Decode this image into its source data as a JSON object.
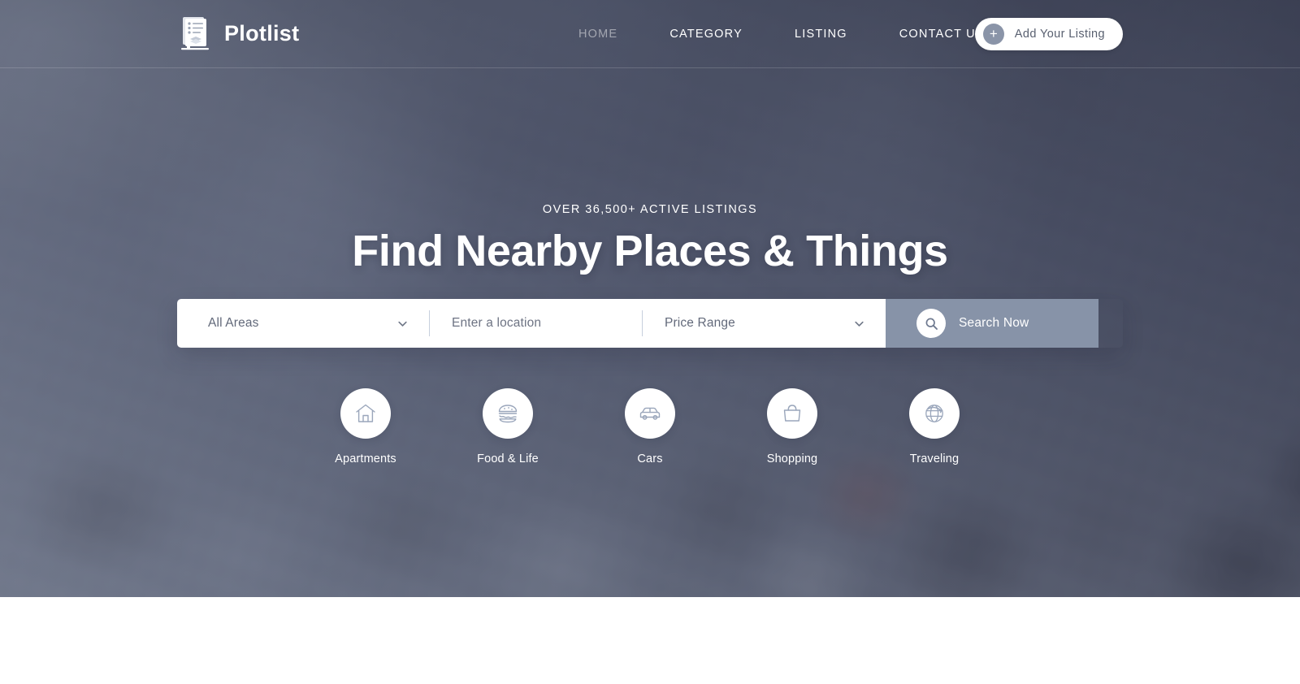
{
  "header": {
    "brand": {
      "name": "Plotlist",
      "logo_icon": "checklist-document-layers-icon"
    },
    "nav": [
      {
        "label": "HOME",
        "active": true
      },
      {
        "label": "CATEGORY",
        "active": false
      },
      {
        "label": "LISTING",
        "active": false
      },
      {
        "label": "CONTACT US",
        "active": false
      }
    ],
    "cta": {
      "label": "Add Your Listing",
      "icon": "plus-circle-icon"
    }
  },
  "hero": {
    "eyebrow": "OVER 36,500+ ACTIVE LISTINGS",
    "headline": "Find Nearby Places & Things",
    "search": {
      "area": {
        "value": "All Areas",
        "icon": "chevron-down-icon"
      },
      "location": {
        "placeholder": "Enter a location",
        "value": ""
      },
      "price": {
        "value": "Price Range",
        "icon": "chevron-down-icon"
      },
      "button": {
        "label": "Search Now",
        "icon": "search-icon"
      }
    },
    "categories": [
      {
        "label": "Apartments",
        "icon": "home-icon"
      },
      {
        "label": "Food & Life",
        "icon": "burger-icon"
      },
      {
        "label": "Cars",
        "icon": "car-icon"
      },
      {
        "label": "Shopping",
        "icon": "handbag-icon"
      },
      {
        "label": "Traveling",
        "icon": "globe-plane-icon"
      }
    ]
  },
  "colors": {
    "accent_search_button": "#8793a8",
    "hero_overlay": "#4a5169",
    "text_on_dark": "#ffffff",
    "field_text": "#62697a",
    "cta_text": "#596070"
  }
}
